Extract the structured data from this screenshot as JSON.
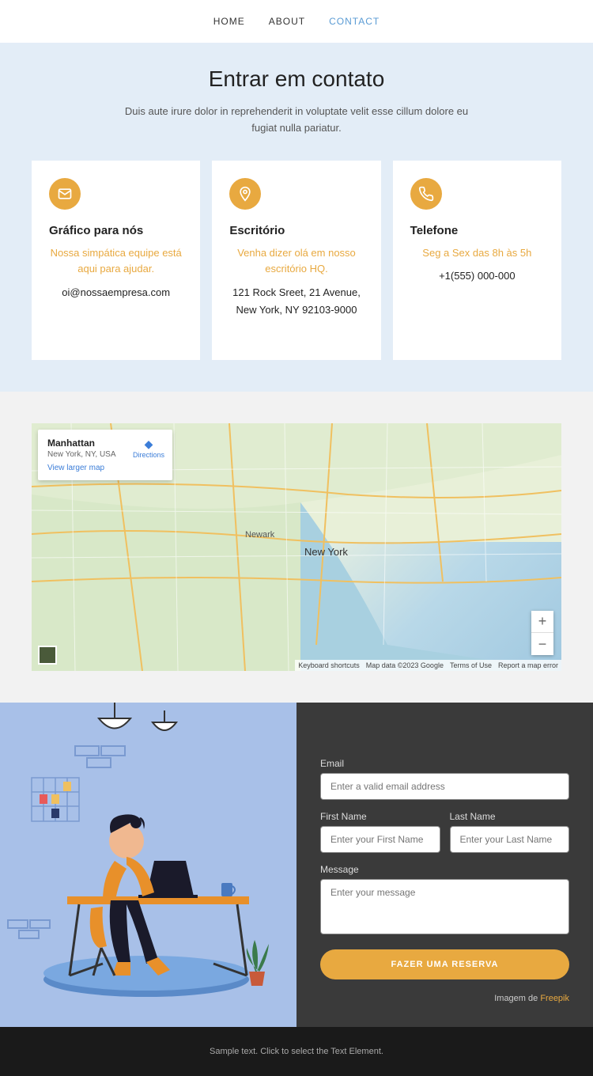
{
  "nav": {
    "home": "HOME",
    "about": "ABOUT",
    "contact": "CONTACT"
  },
  "hero": {
    "title": "Entrar em contato",
    "subtitle": "Duis aute irure dolor in reprehenderit in voluptate velit esse cillum dolore eu fugiat nulla pariatur."
  },
  "cards": {
    "email": {
      "title": "Gráfico para nós",
      "sub": "Nossa simpática equipe está aqui para ajudar.",
      "info": "oi@nossaempresa.com"
    },
    "office": {
      "title": "Escritório",
      "sub": "Venha dizer olá em nosso escritório HQ.",
      "info": "121 Rock Sreet, 21 Avenue, New York, NY 92103-9000"
    },
    "phone": {
      "title": "Telefone",
      "sub": "Seg a Sex das 8h às 5h",
      "info": "+1(555) 000-000"
    }
  },
  "map": {
    "bubble_title": "Manhattan",
    "bubble_sub": "New York, NY, USA",
    "view_larger": "View larger map",
    "directions": "Directions",
    "city": "New York",
    "city2": "Newark",
    "keyboard": "Keyboard shortcuts",
    "mapdata": "Map data ©2023 Google",
    "terms": "Terms of Use",
    "report": "Report a map error"
  },
  "form": {
    "email_label": "Email",
    "email_ph": "Enter a valid email address",
    "fname_label": "First Name",
    "fname_ph": "Enter your First Name",
    "lname_label": "Last Name",
    "lname_ph": "Enter your Last Name",
    "msg_label": "Message",
    "msg_ph": "Enter your message",
    "submit": "FAZER UMA RESERVA",
    "credit_prefix": "Imagem de ",
    "credit_link": "Freepik"
  },
  "footer": {
    "text": "Sample text. Click to select the Text Element."
  }
}
